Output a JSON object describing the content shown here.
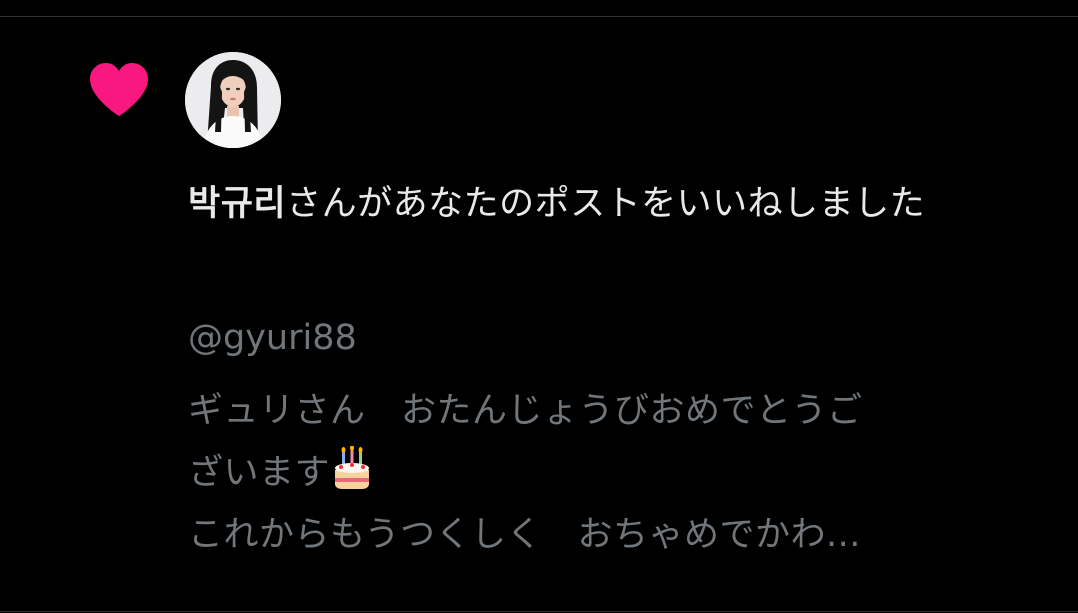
{
  "notification": {
    "type_icon": "heart-icon",
    "type_icon_color": "#f91880",
    "avatar": "user-avatar",
    "user_name": "박규리",
    "action_text": "さんがあなたのポストをいいねしました",
    "handle": "@gyuri88",
    "post_text_lines": [
      "ギュリさん　おたんじょうびおめでとうご",
      "ざいます",
      "これからもうつくしく　おちゃめでかわ..."
    ],
    "post_emoji": "cake-icon"
  },
  "colors": {
    "background": "#000000",
    "primary_text": "#e7e9ea",
    "secondary_text": "#71767b",
    "divider": "#2f3336",
    "like": "#f91880"
  }
}
